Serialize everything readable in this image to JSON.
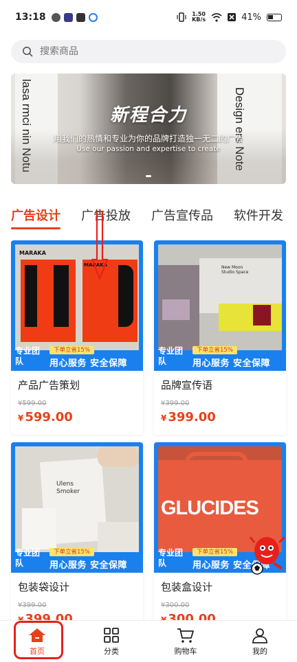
{
  "status_bar": {
    "time": "13:18",
    "speed_value": "1.50",
    "speed_unit": "KB/s",
    "battery": "41%"
  },
  "search": {
    "placeholder": "搜索商品"
  },
  "banner": {
    "title": "新程合力",
    "subtitle": "用我们的热情和专业为你的品牌打造独一无二的广告",
    "subtitle_en": "Use our passion and expertise to create",
    "poster_left": "lasa rmci nin Notu",
    "poster_right": "Design ers Note"
  },
  "tabs": [
    {
      "label": "广告设计",
      "active": true
    },
    {
      "label": "广告投放",
      "active": false
    },
    {
      "label": "广告宣传品",
      "active": false
    },
    {
      "label": "软件开发",
      "active": false
    }
  ],
  "promo": {
    "tag": "专业团队",
    "discount": "下单立省15%",
    "service": "用心服务 安全保障"
  },
  "products": [
    {
      "title": "产品广告策划",
      "original_price": "¥599.00",
      "currency": "¥",
      "price": "599.00"
    },
    {
      "title": "品牌宣传语",
      "original_price": "¥399.00",
      "currency": "¥",
      "price": "399.00"
    },
    {
      "title": "包装袋设计",
      "original_price": "¥399.00",
      "currency": "¥",
      "price": "399.00"
    },
    {
      "title": "包装盒设计",
      "original_price": "¥300.00",
      "currency": "¥",
      "price": "300.00"
    }
  ],
  "product_image_text": {
    "p1": "MARAKA",
    "p2": "New Moon Studio Space",
    "p3": "Ulens Smoker",
    "p4": "GLUCIDES"
  },
  "bottom_nav": [
    {
      "label": "首页",
      "icon": "home-icon",
      "active": true
    },
    {
      "label": "分类",
      "icon": "grid-icon",
      "active": false
    },
    {
      "label": "购物车",
      "icon": "cart-icon",
      "active": false
    },
    {
      "label": "我的",
      "icon": "user-icon",
      "active": false
    }
  ],
  "colors": {
    "accent": "#e8401c",
    "card_frame": "#1a80ee",
    "discount_bg": "#ffe36a"
  }
}
